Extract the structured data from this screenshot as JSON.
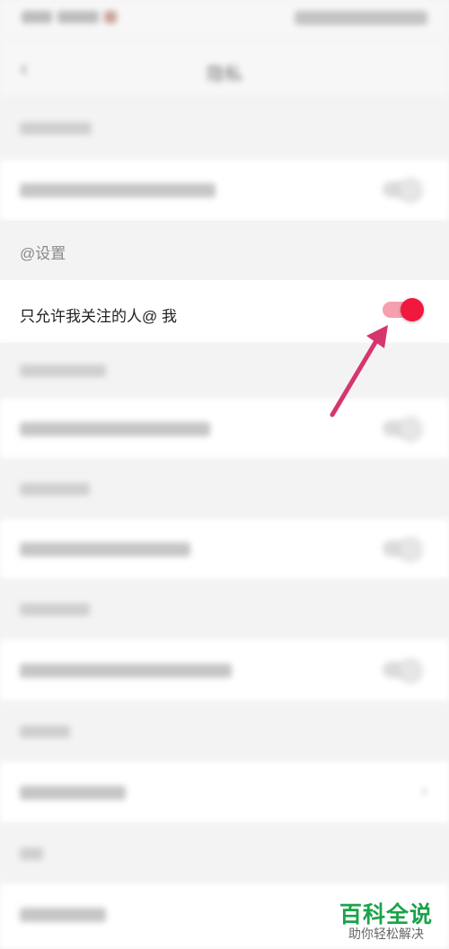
{
  "nav": {
    "back_icon": "chevron-left-icon",
    "title": "隐私"
  },
  "sections": [
    {
      "header": "",
      "row_label": ""
    },
    {
      "header": "@设置",
      "row_label": "只允许我关注的人@ 我"
    },
    {
      "header": "",
      "row_label": ""
    },
    {
      "header": "",
      "row_label": ""
    },
    {
      "header": "",
      "row_label": ""
    },
    {
      "header": "",
      "row_label": ""
    },
    {
      "header": "",
      "row_label": ""
    }
  ],
  "toggle_states": {
    "at_setting": "on",
    "others": "off"
  },
  "colors": {
    "toggle_on": "#f1173f",
    "toggle_track_on": "#f4a0b0",
    "arrow": "#d6356f",
    "watermark": "#1aa34a"
  },
  "watermark": {
    "title": "百科全说",
    "subtitle": "助你轻松解决"
  }
}
